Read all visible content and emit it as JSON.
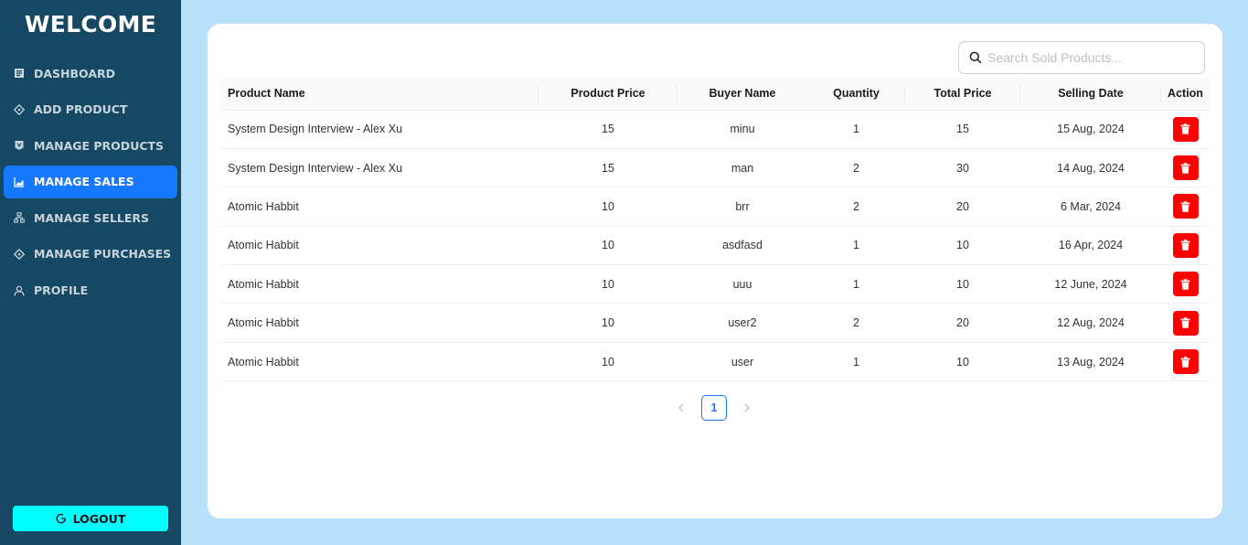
{
  "sidebar": {
    "title": "WELCOME",
    "items": [
      {
        "label": "DASHBOARD",
        "icon": "dashboard-icon"
      },
      {
        "label": "ADD PRODUCT",
        "icon": "add-product-icon"
      },
      {
        "label": "MANAGE PRODUCTS",
        "icon": "products-icon"
      },
      {
        "label": "MANAGE SALES",
        "icon": "chart-icon",
        "active": true
      },
      {
        "label": "MANAGE SELLERS",
        "icon": "sitemap-icon"
      },
      {
        "label": "MANAGE PURCHASES",
        "icon": "purchases-icon"
      },
      {
        "label": "PROFILE",
        "icon": "user-icon"
      }
    ],
    "logout_label": "LOGOUT"
  },
  "search": {
    "placeholder": "Search Sold Products..."
  },
  "table": {
    "headers": [
      "Product Name",
      "Product Price",
      "Buyer Name",
      "Quantity",
      "Total Price",
      "Selling Date",
      "Action"
    ],
    "rows": [
      [
        "System Design Interview - Alex Xu",
        "15",
        "minu",
        "1",
        "15",
        "15 Aug, 2024"
      ],
      [
        "System Design Interview - Alex Xu",
        "15",
        "man",
        "2",
        "30",
        "14 Aug, 2024"
      ],
      [
        "Atomic Habbit",
        "10",
        "brr",
        "2",
        "20",
        "6 Mar, 2024"
      ],
      [
        "Atomic Habbit",
        "10",
        "asdfasd",
        "1",
        "10",
        "16 Apr, 2024"
      ],
      [
        "Atomic Habbit",
        "10",
        "uuu",
        "1",
        "10",
        "12 June, 2024"
      ],
      [
        "Atomic Habbit",
        "10",
        "user2",
        "2",
        "20",
        "12 Aug, 2024"
      ],
      [
        "Atomic Habbit",
        "10",
        "user",
        "1",
        "10",
        "13 Aug, 2024"
      ]
    ]
  },
  "pagination": {
    "current": "1"
  },
  "colors": {
    "sidebar_bg": "#164863",
    "page_bg": "#b8e0f8",
    "active_item": "#1677ff",
    "logout_bg": "#00ffff",
    "delete_button": "#ff0000"
  }
}
